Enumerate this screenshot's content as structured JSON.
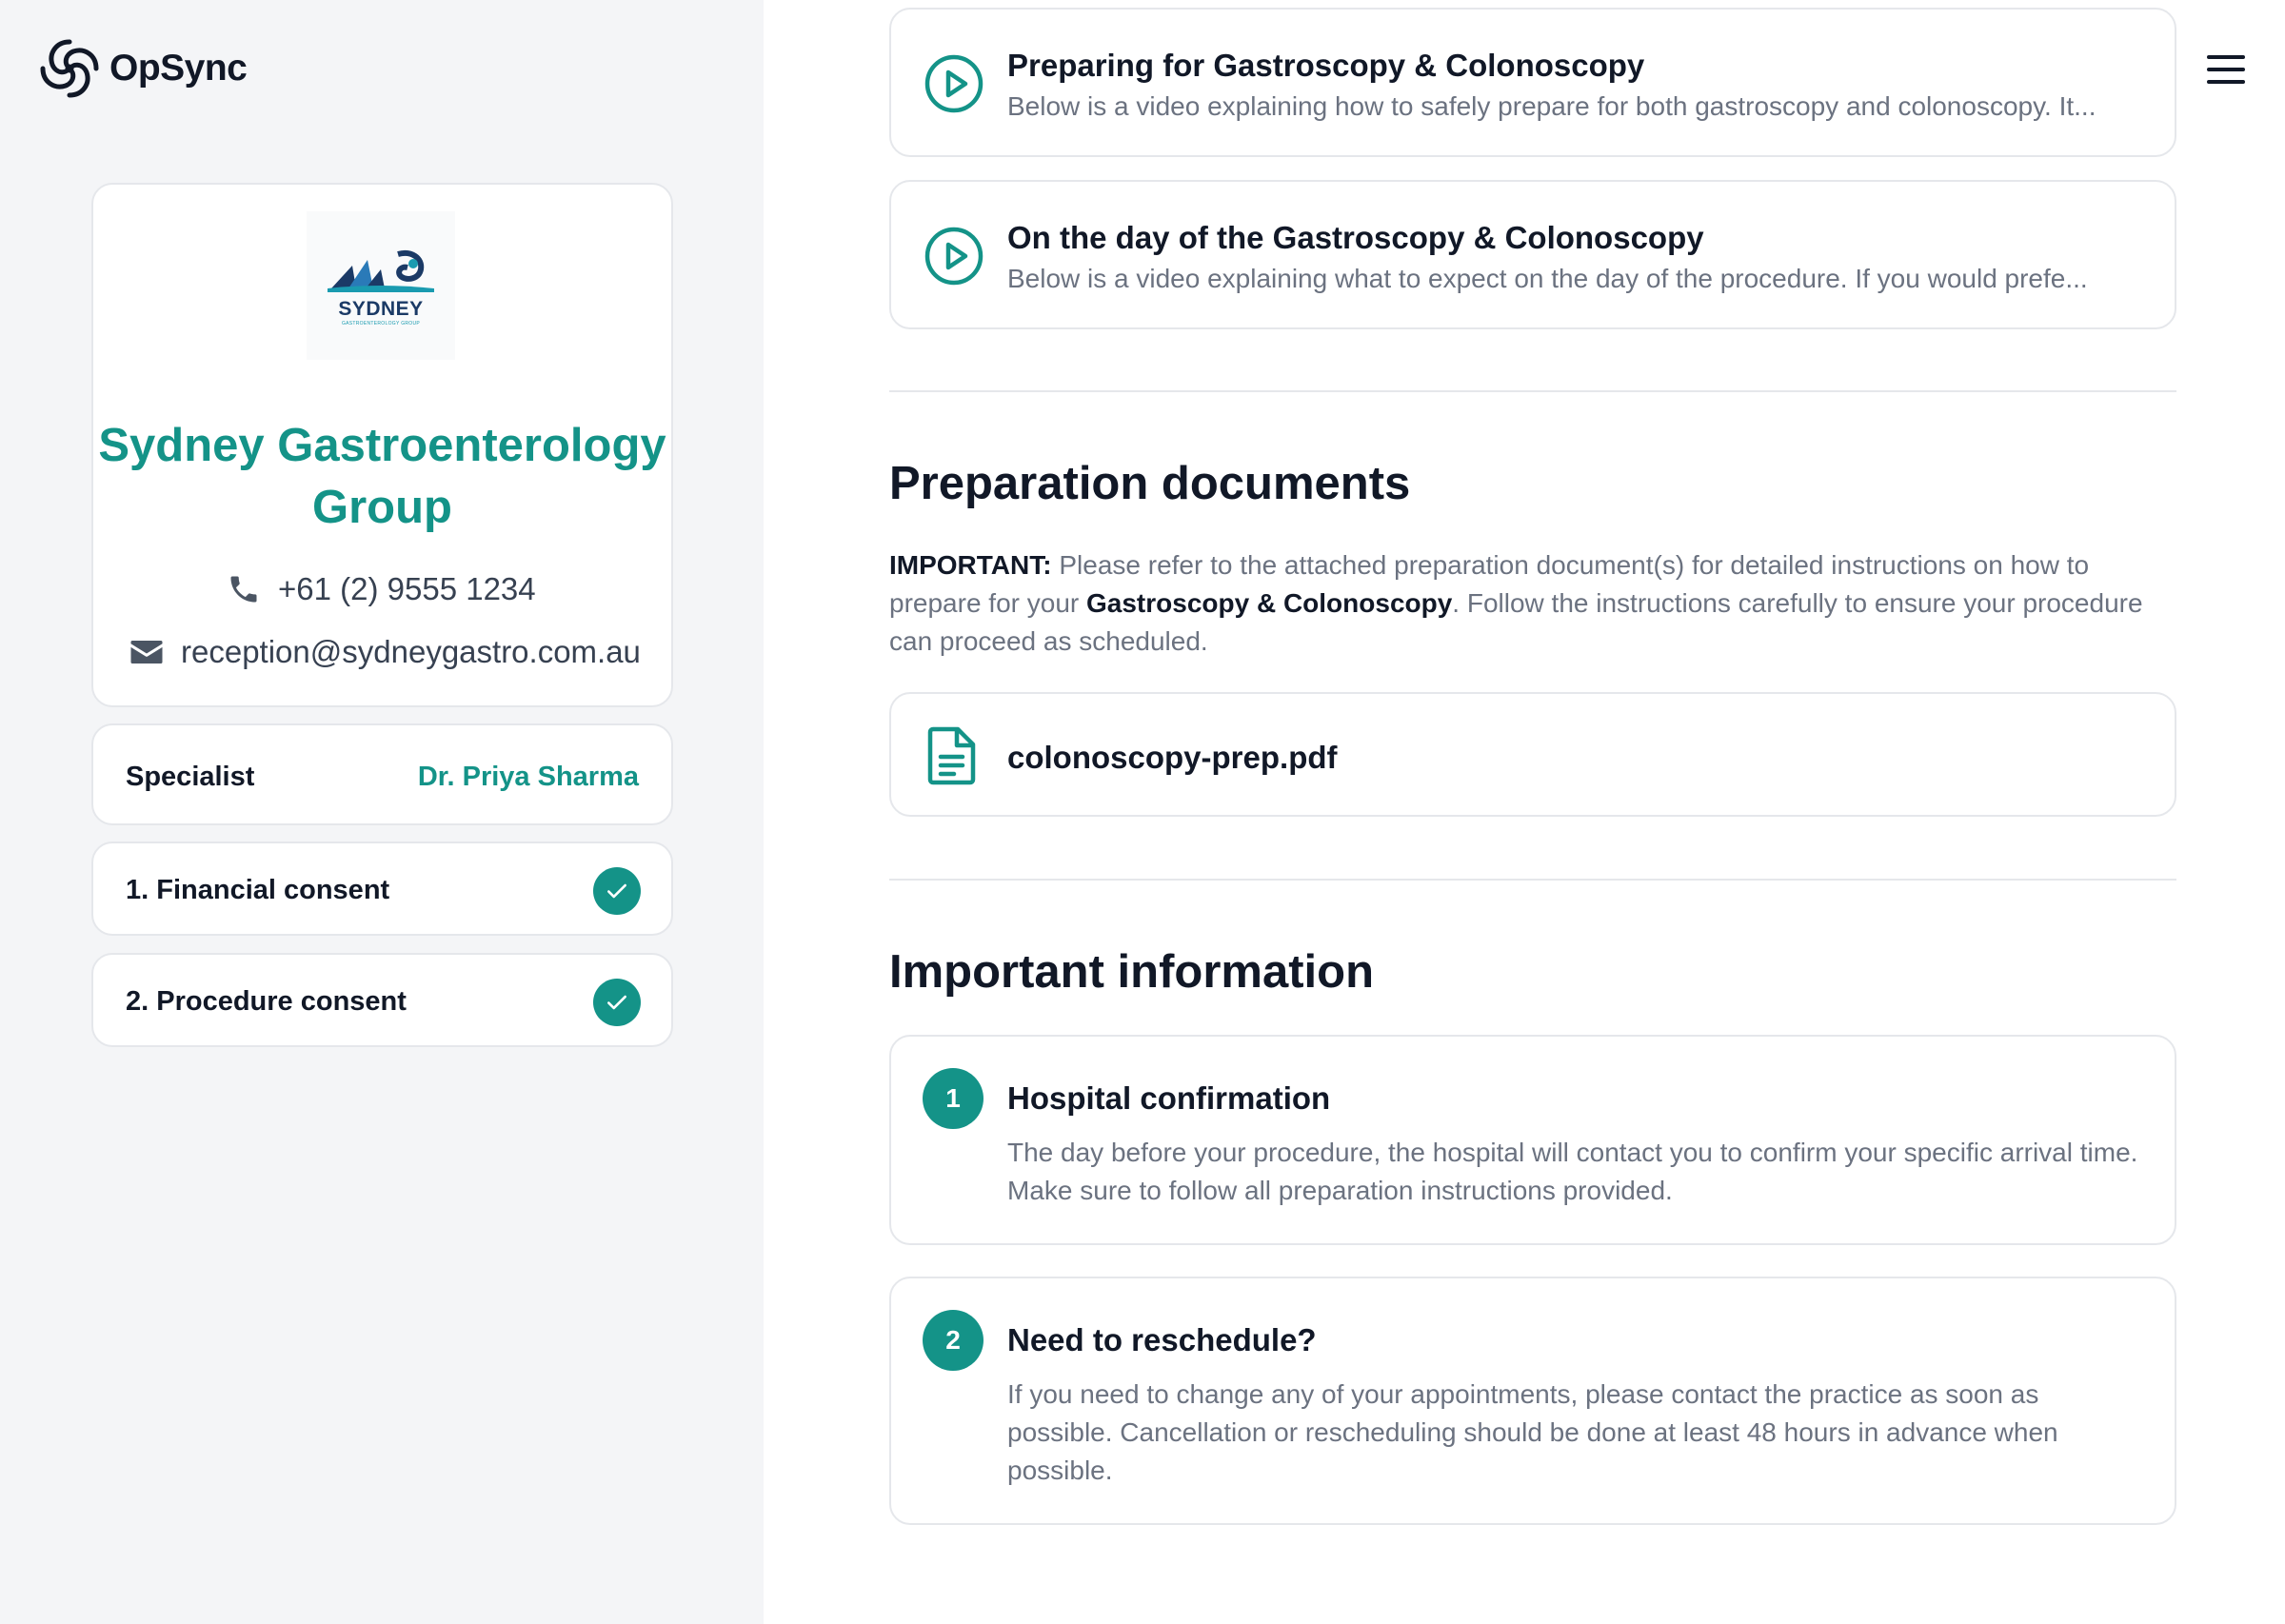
{
  "brand": {
    "name": "OpSync"
  },
  "clinic": {
    "logo_word": "SYDNEY",
    "logo_subtitle": "GASTROENTEROLOGY GROUP",
    "name": "Sydney Gastroenterology Group",
    "phone": "+61 (2) 9555 1234",
    "email": "reception@sydneygastro.com.au"
  },
  "specialist": {
    "label": "Specialist",
    "name": "Dr. Priya Sharma"
  },
  "consents": [
    {
      "label": "1. Financial consent",
      "completed": true
    },
    {
      "label": "2. Procedure consent",
      "completed": true
    }
  ],
  "videos": [
    {
      "title": "Preparing for Gastroscopy & Colonoscopy",
      "description": "Below is a video explaining how to safely prepare for both gastroscopy and colonoscopy. It..."
    },
    {
      "title": "On the day of the Gastroscopy & Colonoscopy",
      "description": "Below is a video explaining what to expect on the day of the procedure. If you would prefe..."
    }
  ],
  "preparation": {
    "heading": "Preparation documents",
    "important_label": "IMPORTANT:",
    "text_part1": " Please refer to the attached preparation document(s) for detailed instructions on how to prepare for your ",
    "procedure_name": "Gastroscopy & Colonoscopy",
    "text_part2": ". Follow the instructions carefully to ensure your procedure can proceed as scheduled.",
    "documents": [
      {
        "name": "colonoscopy-prep.pdf"
      }
    ]
  },
  "important_info": {
    "heading": "Important information",
    "items": [
      {
        "number": "1",
        "title": "Hospital confirmation",
        "description": "The day before your procedure, the hospital will contact you to confirm your specific arrival time. Make sure to follow all preparation instructions provided."
      },
      {
        "number": "2",
        "title": "Need to reschedule?",
        "description": "If you need to change any of your appointments, please contact the practice as soon as possible. Cancellation or rescheduling should be done at least 48 hours in advance when possible."
      }
    ]
  },
  "colors": {
    "accent": "#149388",
    "sidebar_bg": "#f4f5f7",
    "border": "#e5e7eb",
    "muted_text": "#6b7280"
  },
  "icons": [
    "opsync-logo-icon",
    "phone-icon",
    "email-icon",
    "check-icon",
    "play-icon",
    "document-icon",
    "hamburger-menu-icon"
  ]
}
